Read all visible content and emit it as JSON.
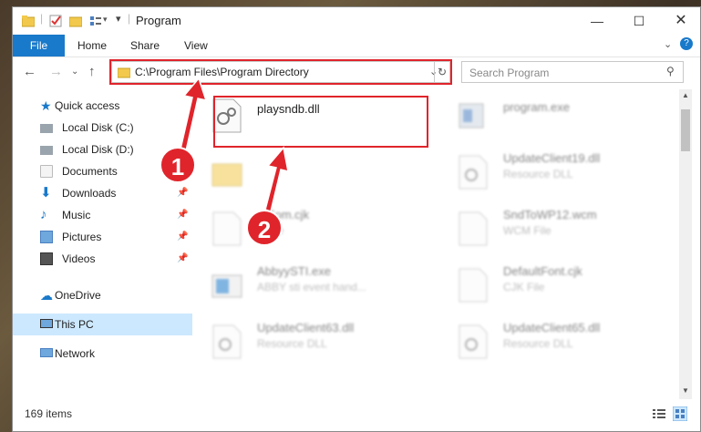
{
  "window": {
    "title": "Program"
  },
  "ribbon": {
    "tabs": [
      "File",
      "Home",
      "Share",
      "View"
    ]
  },
  "address": {
    "path": "C:\\Program Files\\Program Directory"
  },
  "search": {
    "placeholder": "Search Program"
  },
  "nav": {
    "items": [
      {
        "label": "Quick access",
        "icon": "star-icon",
        "pinned": false
      },
      {
        "label": "Local Disk (C:)",
        "icon": "drive-icon",
        "pinned": true
      },
      {
        "label": "Local Disk (D:)",
        "icon": "drive-icon",
        "pinned": false
      },
      {
        "label": "Documents",
        "icon": "documents-icon",
        "pinned": true
      },
      {
        "label": "Downloads",
        "icon": "download-icon",
        "pinned": true
      },
      {
        "label": "Music",
        "icon": "music-icon",
        "pinned": true
      },
      {
        "label": "Pictures",
        "icon": "pictures-icon",
        "pinned": true
      },
      {
        "label": "Videos",
        "icon": "videos-icon",
        "pinned": true
      },
      {
        "label": "OneDrive",
        "icon": "cloud-icon",
        "pinned": false
      },
      {
        "label": "This PC",
        "icon": "pc-icon",
        "pinned": false,
        "selected": true
      },
      {
        "label": "Network",
        "icon": "network-icon",
        "pinned": false
      }
    ]
  },
  "files": [
    {
      "name": "playsndb.dll",
      "type": ""
    },
    {
      "name": "program.exe",
      "type": ""
    },
    {
      "name": "",
      "type": ""
    },
    {
      "name": "UpdateClient19.dll",
      "type": "Resource DLL"
    },
    {
      "name": "...Eom.cjk",
      "type": "...File"
    },
    {
      "name": "SndToWP12.wcm",
      "type": "WCM File"
    },
    {
      "name": "AbbyySTI.exe",
      "type": "ABBY sti event hand..."
    },
    {
      "name": "DefaultFont.cjk",
      "type": "CJK File"
    },
    {
      "name": "UpdateClient63.dll",
      "type": "Resource DLL"
    },
    {
      "name": "UpdateClient65.dll",
      "type": "Resource DLL"
    }
  ],
  "callouts": [
    "1",
    "2"
  ],
  "status": {
    "count": "169 items"
  },
  "colors": {
    "accent": "#1979ca",
    "highlight": "#e0242b",
    "selection": "#cce8ff"
  }
}
